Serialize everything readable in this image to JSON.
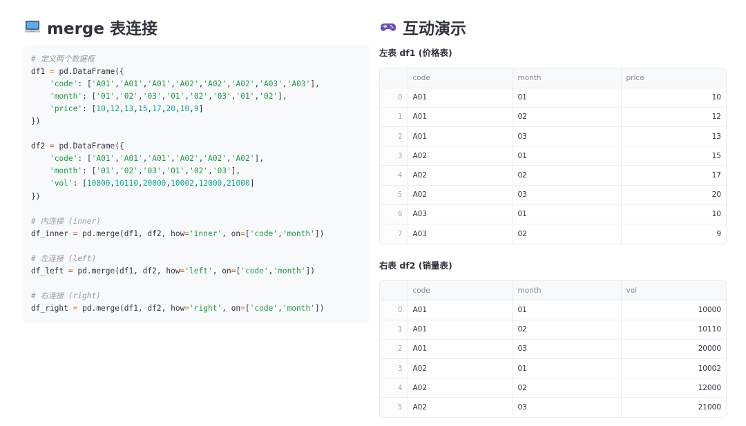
{
  "left": {
    "emoji_icon": "computer-icon",
    "title": "merge 表连接",
    "code_lines": [
      [
        [
          "c",
          "# 定义两个数据框"
        ]
      ],
      [
        [
          "p",
          "df1 "
        ],
        [
          "o",
          "="
        ],
        [
          "p",
          " pd.DataFrame({"
        ]
      ],
      [
        [
          "p",
          "    "
        ],
        [
          "s",
          "'code'"
        ],
        [
          "p",
          ": ["
        ],
        [
          "s",
          "'A01'"
        ],
        [
          "p",
          ","
        ],
        [
          "s",
          "'A01'"
        ],
        [
          "p",
          ","
        ],
        [
          "s",
          "'A01'"
        ],
        [
          "p",
          ","
        ],
        [
          "s",
          "'A02'"
        ],
        [
          "p",
          ","
        ],
        [
          "s",
          "'A02'"
        ],
        [
          "p",
          ","
        ],
        [
          "s",
          "'A02'"
        ],
        [
          "p",
          ","
        ],
        [
          "s",
          "'A03'"
        ],
        [
          "p",
          ","
        ],
        [
          "s",
          "'A03'"
        ],
        [
          "p",
          "],"
        ]
      ],
      [
        [
          "p",
          "    "
        ],
        [
          "s",
          "'month'"
        ],
        [
          "p",
          ": ["
        ],
        [
          "s",
          "'01'"
        ],
        [
          "p",
          ","
        ],
        [
          "s",
          "'02'"
        ],
        [
          "p",
          ","
        ],
        [
          "s",
          "'03'"
        ],
        [
          "p",
          ","
        ],
        [
          "s",
          "'01'"
        ],
        [
          "p",
          ","
        ],
        [
          "s",
          "'02'"
        ],
        [
          "p",
          ","
        ],
        [
          "s",
          "'03'"
        ],
        [
          "p",
          ","
        ],
        [
          "s",
          "'01'"
        ],
        [
          "p",
          ","
        ],
        [
          "s",
          "'02'"
        ],
        [
          "p",
          "],"
        ]
      ],
      [
        [
          "p",
          "    "
        ],
        [
          "s",
          "'price'"
        ],
        [
          "p",
          ": ["
        ],
        [
          "n",
          "10"
        ],
        [
          "p",
          ","
        ],
        [
          "n",
          "12"
        ],
        [
          "p",
          ","
        ],
        [
          "n",
          "13"
        ],
        [
          "p",
          ","
        ],
        [
          "n",
          "15"
        ],
        [
          "p",
          ","
        ],
        [
          "n",
          "17"
        ],
        [
          "p",
          ","
        ],
        [
          "n",
          "20"
        ],
        [
          "p",
          ","
        ],
        [
          "n",
          "10"
        ],
        [
          "p",
          ","
        ],
        [
          "n",
          "9"
        ],
        [
          "p",
          "]"
        ]
      ],
      [
        [
          "p",
          "})"
        ]
      ],
      [
        [
          "p",
          ""
        ]
      ],
      [
        [
          "p",
          "df2 "
        ],
        [
          "o",
          "="
        ],
        [
          "p",
          " pd.DataFrame({"
        ]
      ],
      [
        [
          "p",
          "    "
        ],
        [
          "s",
          "'code'"
        ],
        [
          "p",
          ": ["
        ],
        [
          "s",
          "'A01'"
        ],
        [
          "p",
          ","
        ],
        [
          "s",
          "'A01'"
        ],
        [
          "p",
          ","
        ],
        [
          "s",
          "'A01'"
        ],
        [
          "p",
          ","
        ],
        [
          "s",
          "'A02'"
        ],
        [
          "p",
          ","
        ],
        [
          "s",
          "'A02'"
        ],
        [
          "p",
          ","
        ],
        [
          "s",
          "'A02'"
        ],
        [
          "p",
          "],"
        ]
      ],
      [
        [
          "p",
          "    "
        ],
        [
          "s",
          "'month'"
        ],
        [
          "p",
          ": ["
        ],
        [
          "s",
          "'01'"
        ],
        [
          "p",
          ","
        ],
        [
          "s",
          "'02'"
        ],
        [
          "p",
          ","
        ],
        [
          "s",
          "'03'"
        ],
        [
          "p",
          ","
        ],
        [
          "s",
          "'01'"
        ],
        [
          "p",
          ","
        ],
        [
          "s",
          "'02'"
        ],
        [
          "p",
          ","
        ],
        [
          "s",
          "'03'"
        ],
        [
          "p",
          "],"
        ]
      ],
      [
        [
          "p",
          "    "
        ],
        [
          "s",
          "'vol'"
        ],
        [
          "p",
          ": ["
        ],
        [
          "n",
          "10000"
        ],
        [
          "p",
          ","
        ],
        [
          "n",
          "10110"
        ],
        [
          "p",
          ","
        ],
        [
          "n",
          "20000"
        ],
        [
          "p",
          ","
        ],
        [
          "n",
          "10002"
        ],
        [
          "p",
          ","
        ],
        [
          "n",
          "12000"
        ],
        [
          "p",
          ","
        ],
        [
          "n",
          "21000"
        ],
        [
          "p",
          "]"
        ]
      ],
      [
        [
          "p",
          "})"
        ]
      ],
      [
        [
          "p",
          ""
        ]
      ],
      [
        [
          "c",
          "# 内连接 (inner)"
        ]
      ],
      [
        [
          "p",
          "df_inner "
        ],
        [
          "o",
          "="
        ],
        [
          "p",
          " pd.merge(df1, df2, how"
        ],
        [
          "o",
          "="
        ],
        [
          "s",
          "'inner'"
        ],
        [
          "p",
          ", on"
        ],
        [
          "o",
          "="
        ],
        [
          "p",
          "["
        ],
        [
          "s",
          "'code'"
        ],
        [
          "p",
          ","
        ],
        [
          "s",
          "'month'"
        ],
        [
          "p",
          "])"
        ]
      ],
      [
        [
          "p",
          ""
        ]
      ],
      [
        [
          "c",
          "# 左连接 (left)"
        ]
      ],
      [
        [
          "p",
          "df_left "
        ],
        [
          "o",
          "="
        ],
        [
          "p",
          " pd.merge(df1, df2, how"
        ],
        [
          "o",
          "="
        ],
        [
          "s",
          "'left'"
        ],
        [
          "p",
          ", on"
        ],
        [
          "o",
          "="
        ],
        [
          "p",
          "["
        ],
        [
          "s",
          "'code'"
        ],
        [
          "p",
          ","
        ],
        [
          "s",
          "'month'"
        ],
        [
          "p",
          "])"
        ]
      ],
      [
        [
          "p",
          ""
        ]
      ],
      [
        [
          "c",
          "# 右连接 (right)"
        ]
      ],
      [
        [
          "p",
          "df_right "
        ],
        [
          "o",
          "="
        ],
        [
          "p",
          " pd.merge(df1, df2, how"
        ],
        [
          "o",
          "="
        ],
        [
          "s",
          "'right'"
        ],
        [
          "p",
          ", on"
        ],
        [
          "o",
          "="
        ],
        [
          "p",
          "["
        ],
        [
          "s",
          "'code'"
        ],
        [
          "p",
          ","
        ],
        [
          "s",
          "'month'"
        ],
        [
          "p",
          "])"
        ]
      ]
    ]
  },
  "right": {
    "emoji_icon": "game-controller-icon",
    "title": "互动演示",
    "table1": {
      "caption": "左表 df1 (价格表)",
      "columns": [
        "",
        "code",
        "month",
        "price"
      ],
      "rows": [
        [
          "0",
          "A01",
          "01",
          "10"
        ],
        [
          "1",
          "A01",
          "02",
          "12"
        ],
        [
          "2",
          "A01",
          "03",
          "13"
        ],
        [
          "3",
          "A02",
          "01",
          "15"
        ],
        [
          "4",
          "A02",
          "02",
          "17"
        ],
        [
          "5",
          "A02",
          "03",
          "20"
        ],
        [
          "6",
          "A03",
          "01",
          "10"
        ],
        [
          "7",
          "A03",
          "02",
          "9"
        ]
      ]
    },
    "table2": {
      "caption": "右表 df2 (销量表)",
      "columns": [
        "",
        "code",
        "month",
        "vol"
      ],
      "rows": [
        [
          "0",
          "A01",
          "01",
          "10000"
        ],
        [
          "1",
          "A01",
          "02",
          "10110"
        ],
        [
          "2",
          "A01",
          "03",
          "20000"
        ],
        [
          "3",
          "A02",
          "01",
          "10002"
        ],
        [
          "4",
          "A02",
          "02",
          "12000"
        ],
        [
          "5",
          "A02",
          "03",
          "21000"
        ]
      ]
    }
  }
}
